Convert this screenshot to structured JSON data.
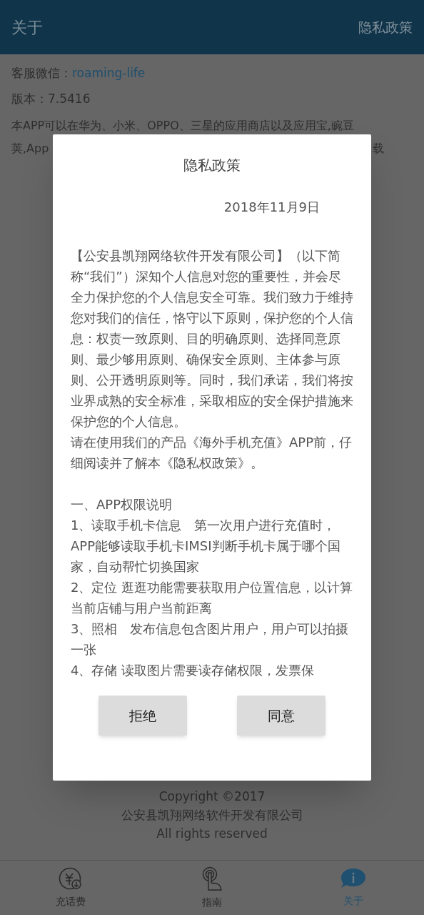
{
  "header": {
    "title": "关于",
    "action": "隐私政策"
  },
  "info": {
    "wechat_label": "客服微信：",
    "wechat_link": "roaming-life",
    "version": "版本：7.5416",
    "intro_line_1": "本APP可以在华为、小米、OPPO、三星的应用商店以及应用宝,豌豆",
    "intro_line_2_start": "荚,App",
    "intro_line_2_end": "载"
  },
  "footer": [
    "Copyright ©2017",
    "公安县凯翔网络软件开发有限公司",
    "All rights reserved"
  ],
  "dialog": {
    "title": "隐私政策",
    "date": "2018年11月9日",
    "paragraphs": [
      {
        "kind": "text",
        "text": "【公安县凯翔网络软件开发有限公司】（以下简称“我们”）深知个人信息对您的重要性，并会尽全力保护您的个人信息安全可靠。我们致力于维持您对我们的信任，恪守以下原则，保护您的个人信息：权责一致原则、目的明确原则、选择同意原则、最少够用原则、确保安全原则、主体参与原则、公开透明原则等。同时，我们承诺，我们将按业界成熟的安全标准，采取相应的安全保护措施来保护您的个人信息。"
      },
      {
        "kind": "text",
        "text": "请在使用我们的产品《海外手机充值》APP前，仔细阅读并了解本《隐私权政策》。"
      },
      {
        "kind": "section",
        "text": "一、APP权限说明"
      },
      {
        "kind": "text",
        "text": "1、读取手机卡信息　第一次用户进行充值时，APP能够读取手机卡IMSI判断手机卡属于哪个国家，自动帮忙切换国家"
      },
      {
        "kind": "text",
        "text": "2、定位 逛逛功能需要获取用户位置信息，以计算当前店铺与用户当前距离"
      },
      {
        "kind": "text",
        "text": "3、照相　发布信息包含图片用户，用户可以拍摄一张"
      },
      {
        "kind": "text",
        "text": "4、存储 读取图片需要读存储权限，发票保"
      }
    ],
    "buttons": [
      "拒绝",
      "同意"
    ]
  },
  "nav": [
    {
      "kind": "recharge",
      "label": "充话费",
      "selected": false
    },
    {
      "kind": "guide",
      "label": "指南",
      "selected": false
    },
    {
      "kind": "about",
      "label": "关于",
      "selected": true
    }
  ]
}
